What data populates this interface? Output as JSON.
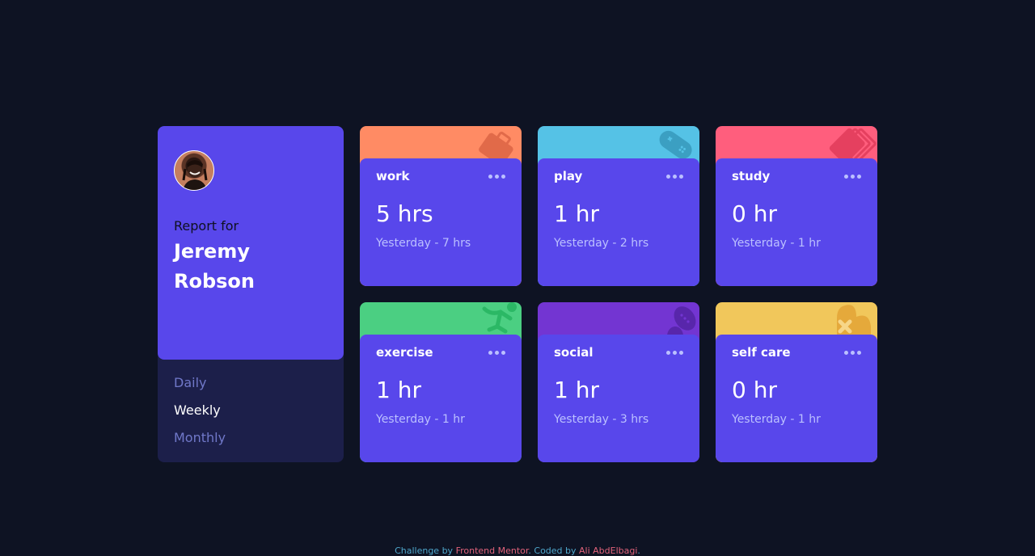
{
  "profile": {
    "report_label": "Report for",
    "first_name": "Jeremy",
    "last_name": "Robson"
  },
  "periods": [
    {
      "label": "Daily",
      "active": false
    },
    {
      "label": "Weekly",
      "active": true
    },
    {
      "label": "Monthly",
      "active": false
    }
  ],
  "activities": [
    {
      "title": "work",
      "current": "5 hrs",
      "previous": "Yesterday - 7 hrs",
      "color": "#ff8b64",
      "icon": "briefcase-icon"
    },
    {
      "title": "play",
      "current": "1 hr",
      "previous": "Yesterday - 2 hrs",
      "color": "#55c2e6",
      "icon": "gamepad-icon"
    },
    {
      "title": "study",
      "current": "0 hr",
      "previous": "Yesterday - 1 hr",
      "color": "#ff5e7d",
      "icon": "book-icon"
    },
    {
      "title": "exercise",
      "current": "1 hr",
      "previous": "Yesterday - 1 hr",
      "color": "#4bcf82",
      "icon": "running-icon"
    },
    {
      "title": "social",
      "current": "1 hr",
      "previous": "Yesterday - 3 hrs",
      "color": "#7335d2",
      "icon": "social-bubble-icon"
    },
    {
      "title": "self care",
      "current": "0 hr",
      "previous": "Yesterday - 1 hr",
      "color": "#f1c75b",
      "icon": "heart-icon"
    }
  ],
  "attribution": {
    "prefix": "Challenge by",
    "challenge_link": "Frontend Mentor",
    "middle": ". Coded by",
    "author_link": "Ali AbdElbagi",
    "suffix": "."
  },
  "colors": {
    "background": "#0e1323",
    "card": "#5847eb",
    "profile_bottom": "#1c1f4a",
    "muted_text": "#bbc0ff",
    "period_inactive": "#7078c9"
  }
}
